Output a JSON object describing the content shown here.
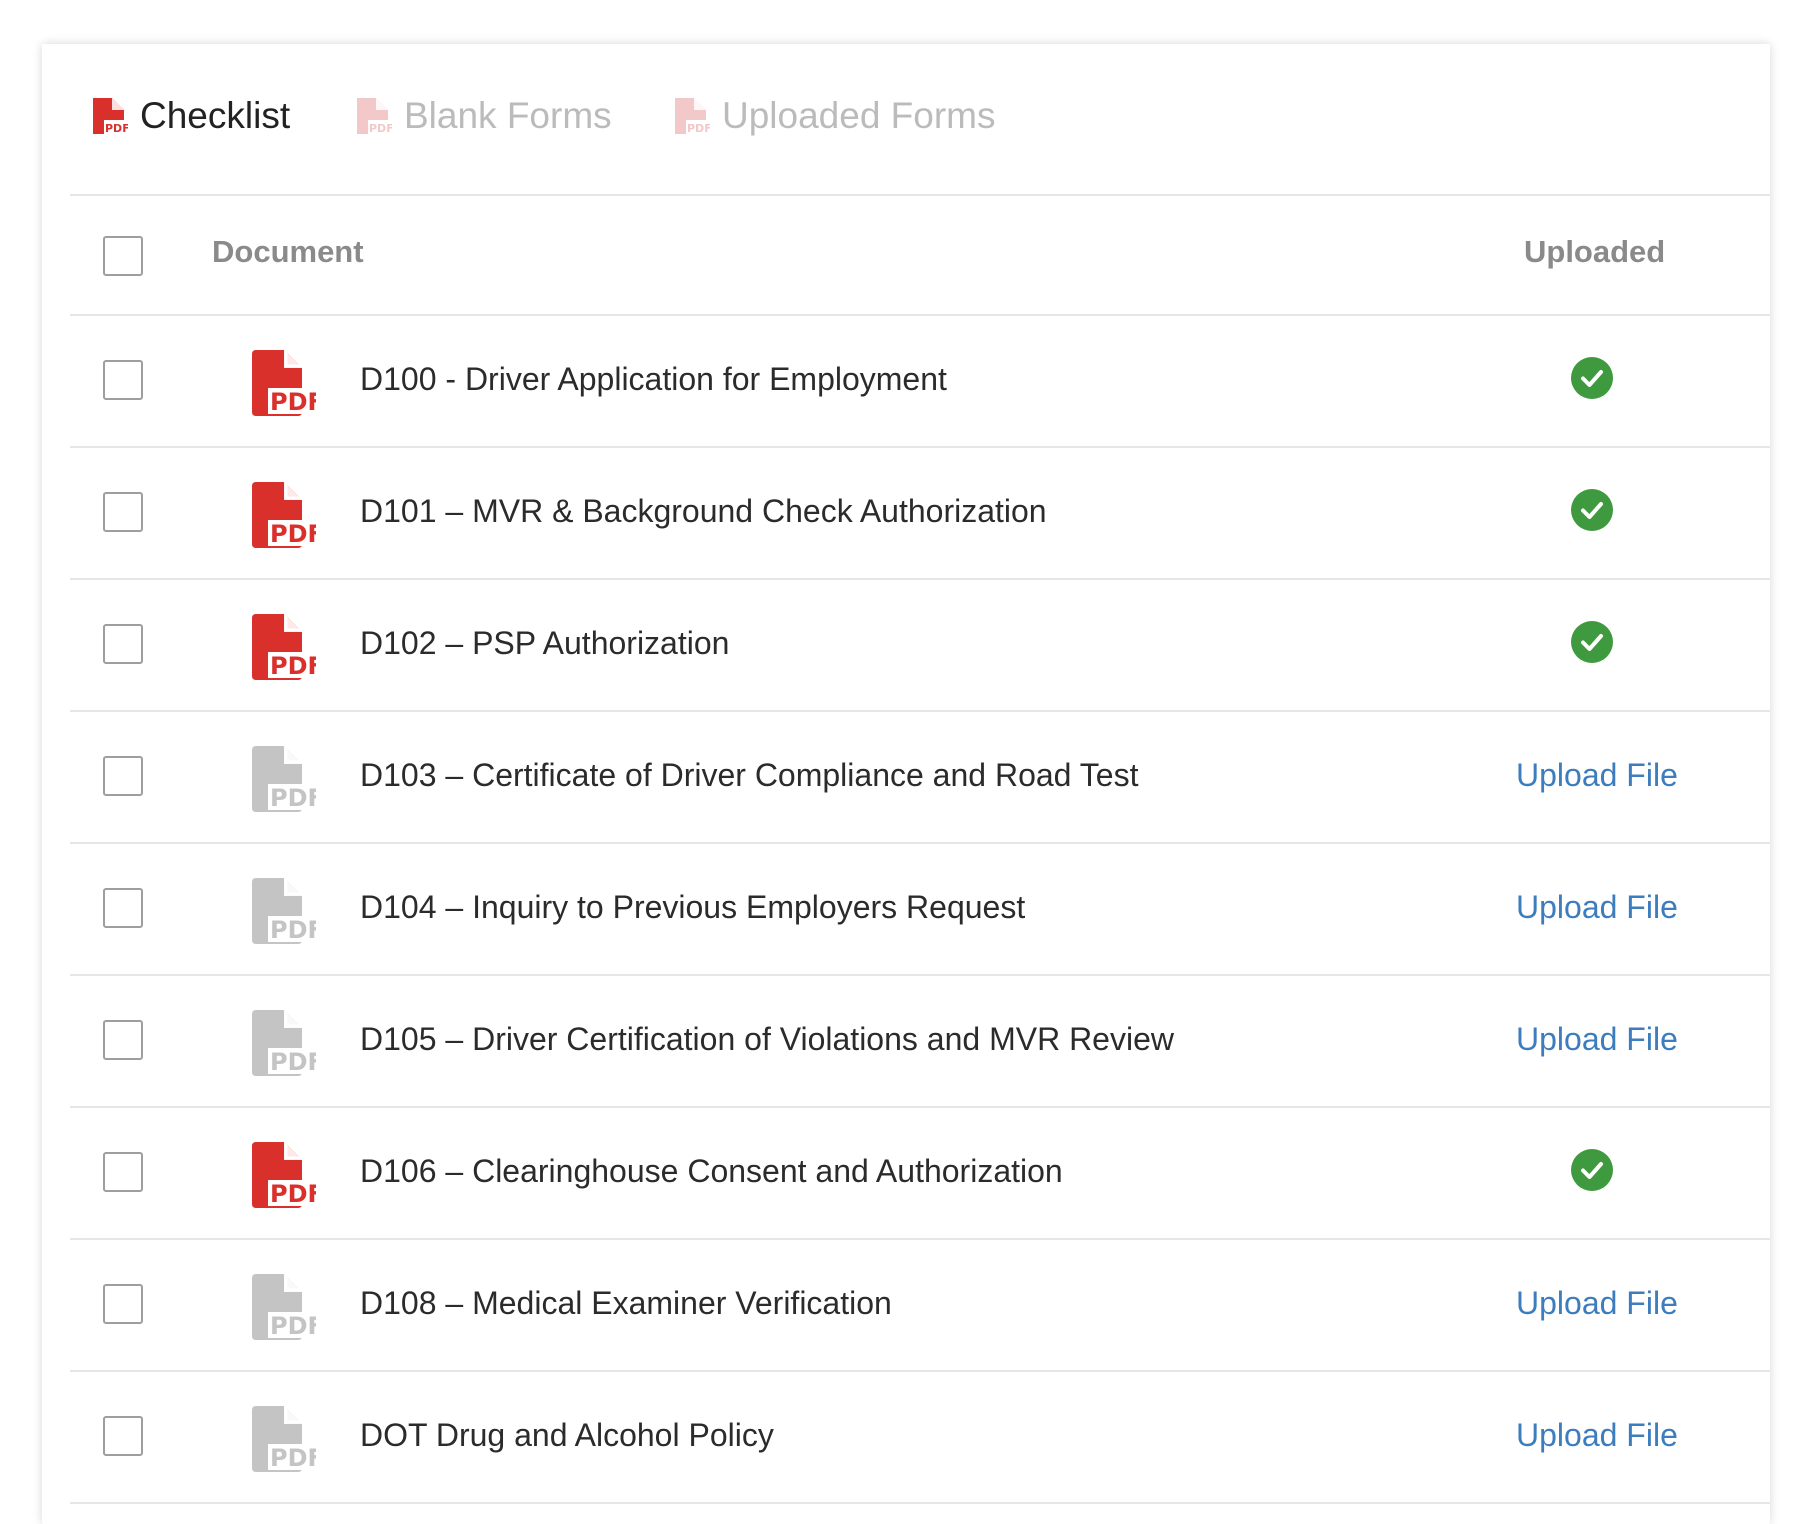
{
  "tabs": [
    {
      "label": "Checklist",
      "icon": "pdf-icon",
      "active": true
    },
    {
      "label": "Blank Forms",
      "icon": "pdf-icon",
      "active": false
    },
    {
      "label": "Uploaded Forms",
      "icon": "pdf-icon",
      "active": false
    }
  ],
  "table": {
    "columns": {
      "document": "Document",
      "uploaded": "Uploaded"
    },
    "rows": [
      {
        "title": "D100 - Driver Application for Employment",
        "uploaded": true
      },
      {
        "title": "D101 – MVR & Background Check Authorization",
        "uploaded": true
      },
      {
        "title": "D102 – PSP Authorization",
        "uploaded": true
      },
      {
        "title": "D103 – Certificate of Driver Compliance and Road Test",
        "uploaded": false,
        "action": "Upload File"
      },
      {
        "title": "D104 – Inquiry to Previous Employers Request",
        "uploaded": false,
        "action": "Upload File"
      },
      {
        "title": "D105 – Driver Certification of Violations and MVR Review",
        "uploaded": false,
        "action": "Upload File"
      },
      {
        "title": "D106 – Clearinghouse Consent and Authorization",
        "uploaded": true
      },
      {
        "title": "D108 – Medical Examiner Verification",
        "uploaded": false,
        "action": "Upload File"
      },
      {
        "title": "DOT Drug and Alcohol Policy",
        "uploaded": false,
        "action": "Upload File"
      }
    ]
  },
  "pdf_badge": "PDF",
  "colors": {
    "pdf_active": "#d9302c",
    "pdf_inactive": "#c4c4c4",
    "tab_icon_faded": "#f2c9c8",
    "check_green": "#3f9a3f",
    "link_blue": "#3d7dbe"
  }
}
